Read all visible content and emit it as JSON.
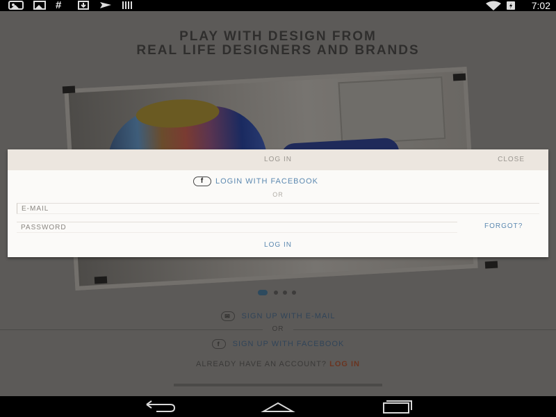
{
  "status_bar": {
    "time": "7:02",
    "icons": [
      "gallery-icon",
      "image-icon",
      "hash-icon",
      "download-icon",
      "send-icon",
      "barcode-icon",
      "wifi-icon",
      "battery-icon"
    ]
  },
  "background": {
    "headline_line1": "PLAY WITH DESIGN FROM",
    "headline_line2": "REAL LIFE DESIGNERS AND BRANDS",
    "signup_email": "SIGN UP WITH E-MAIL",
    "or": "OR",
    "signup_facebook": "SIGN UP WITH FACEBOOK",
    "already_text": "ALREADY HAVE AN ACCOUNT?",
    "already_link": "LOG IN",
    "carousel": {
      "count": 4,
      "active_index": 0
    }
  },
  "dialog": {
    "title": "LOG IN",
    "close_label": "CLOSE",
    "facebook_login": "LOGIN WITH FACEBOOK",
    "or": "OR",
    "email_placeholder": "E-MAIL",
    "password_placeholder": "PASSWORD",
    "forgot_label": "FORGOT?",
    "login_button": "LOG IN"
  },
  "nav_bar": {
    "buttons": [
      "back-icon",
      "home-icon",
      "recent-apps-icon"
    ]
  },
  "colors": {
    "accent_link": "#5b88b0",
    "dialog_header": "#ece6df",
    "overlay": "#5c5a58"
  }
}
